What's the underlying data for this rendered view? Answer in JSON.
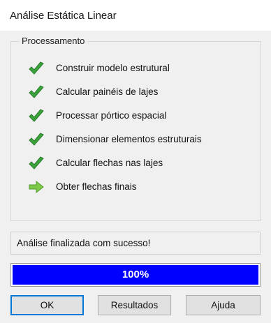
{
  "window": {
    "title": "Análise Estática Linear"
  },
  "group": {
    "title": "Processamento",
    "steps": [
      {
        "label": "Construir modelo estrutural",
        "icon": "checkmark-icon"
      },
      {
        "label": "Calcular painéis de lajes",
        "icon": "checkmark-icon"
      },
      {
        "label": "Processar pórtico espacial",
        "icon": "checkmark-icon"
      },
      {
        "label": "Dimensionar elementos estruturais",
        "icon": "checkmark-icon"
      },
      {
        "label": "Calcular flechas nas lajes",
        "icon": "checkmark-icon"
      },
      {
        "label": "Obter flechas finais",
        "icon": "arrow-right-icon"
      }
    ]
  },
  "status": {
    "message": "Análise finalizada com sucesso!"
  },
  "progress": {
    "value": 100,
    "label": "100%",
    "fill_color": "#0000ff"
  },
  "buttons": {
    "ok": "OK",
    "results": "Resultados",
    "help": "Ajuda"
  },
  "colors": {
    "check": "#3aa33a",
    "arrow": "#7ec84a"
  }
}
